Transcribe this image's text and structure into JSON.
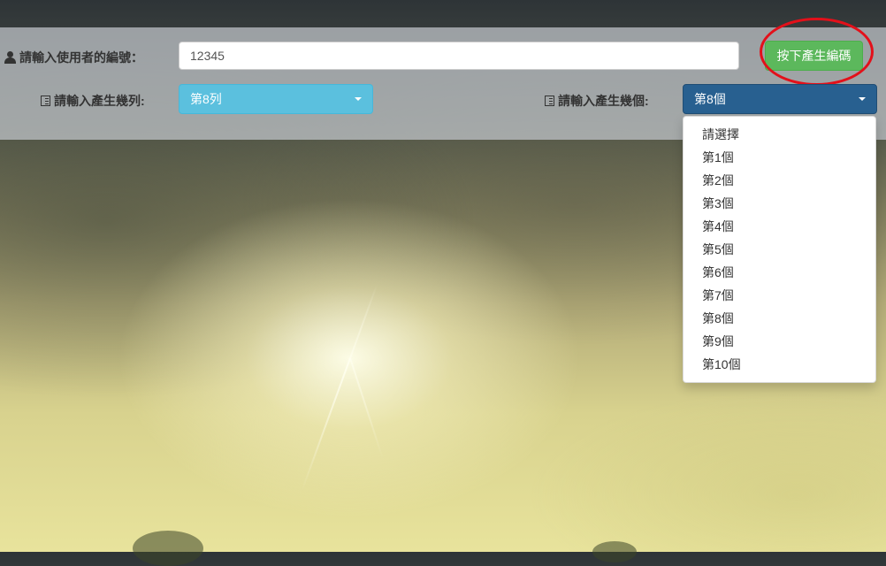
{
  "form": {
    "user_id_label": "請輸入使用者的編號：",
    "user_id_value": "12345",
    "generate_button": "按下產生編碼",
    "rows_label": "請輸入產生幾列:",
    "rows_selected": "第8列",
    "count_label": "請輸入產生幾個:",
    "count_selected": "第8個"
  },
  "dropdown": {
    "options": [
      "請選擇",
      "第1個",
      "第2個",
      "第3個",
      "第4個",
      "第5個",
      "第6個",
      "第7個",
      "第8個",
      "第9個",
      "第10個"
    ]
  },
  "colors": {
    "button_green": "#5cb85c",
    "select_info": "#5bc0de",
    "select_primary": "#286090",
    "highlight_red": "#e3101a"
  },
  "icons": {
    "user": "user-icon",
    "list": "list-icon",
    "caret": "caret-down-icon"
  }
}
